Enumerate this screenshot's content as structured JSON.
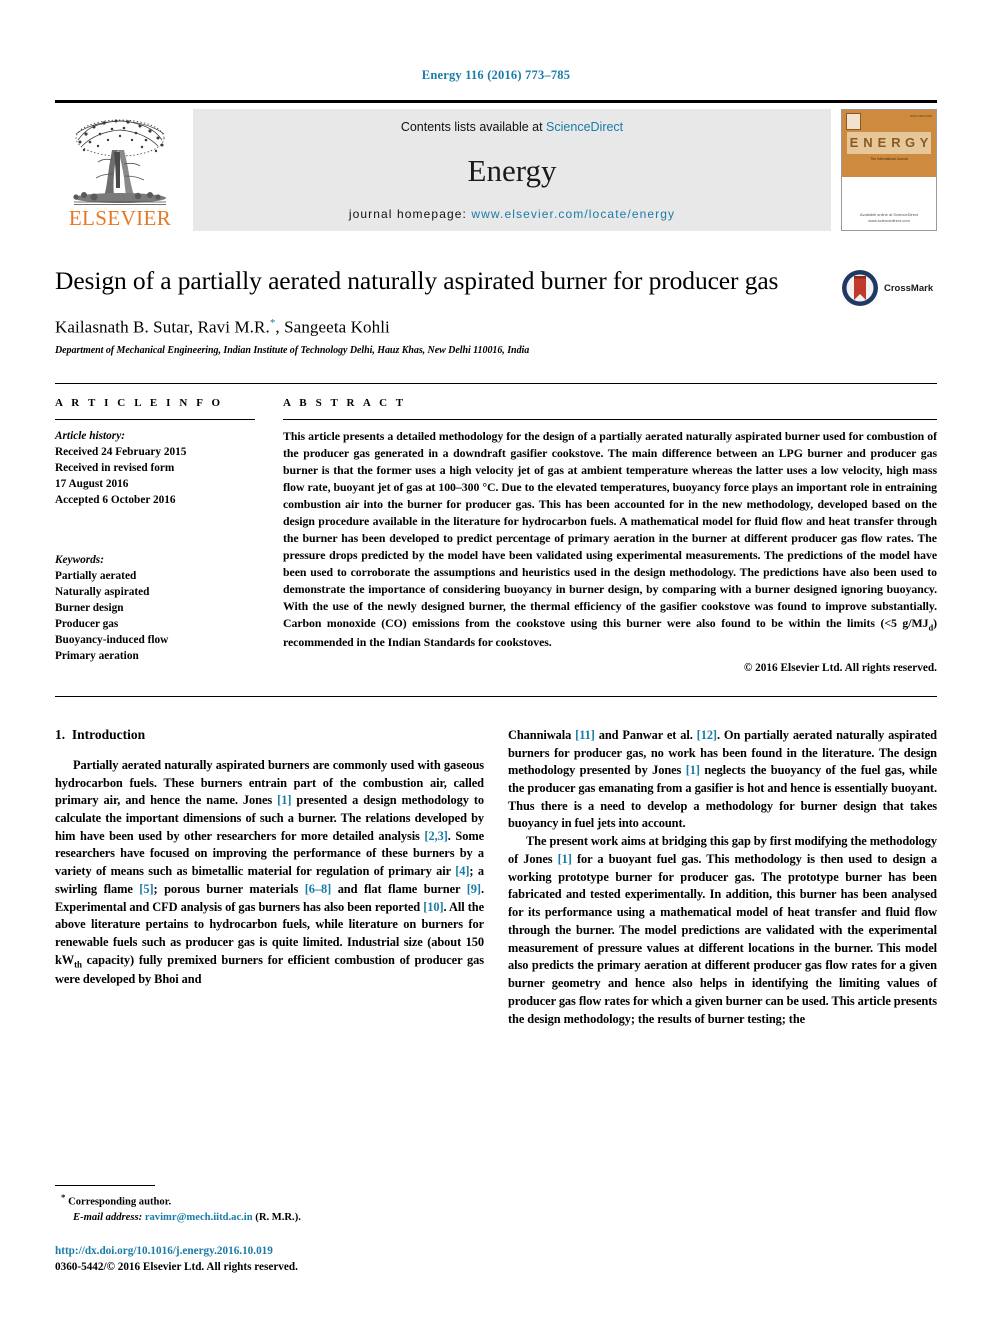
{
  "running_head": "Energy 116 (2016) 773–785",
  "masthead": {
    "publisher": "ELSEVIER",
    "contents_prefix": "Contents lists available at ",
    "contents_link": "ScienceDirect",
    "journal_name": "Energy",
    "homepage_prefix": "journal homepage: ",
    "homepage_url": "www.elsevier.com/locate/energy",
    "cover": {
      "title": "ENERGY",
      "subtitle": "The International Journal",
      "corner_note": "ISSN 0360-5442",
      "publisher_note": "Available online at\nScienceDirect\nwww.sciencedirect.com"
    }
  },
  "article": {
    "title": "Design of a partially aerated naturally aspirated burner for producer gas",
    "authors": "Kailasnath B. Sutar, Ravi M.R.",
    "author_marker": "*",
    "authors_tail": ", Sangeeta Kohli",
    "affiliation": "Department of Mechanical Engineering, Indian Institute of Technology Delhi, Hauz Khas, New Delhi 110016, India",
    "crossmark_label": "CrossMark"
  },
  "article_info": {
    "heading": "A R T I C L E   I N F O",
    "history_label": "Article history:",
    "history": [
      "Received 24 February 2015",
      "Received in revised form",
      "17 August 2016",
      "Accepted 6 October 2016"
    ],
    "keywords_label": "Keywords:",
    "keywords": [
      "Partially aerated",
      "Naturally aspirated",
      "Burner design",
      "Producer gas",
      "Buoyancy-induced flow",
      "Primary aeration"
    ]
  },
  "abstract": {
    "heading": "A B S T R A C T",
    "text": "This article presents a detailed methodology for the design of a partially aerated naturally aspirated burner used for combustion of the producer gas generated in a downdraft gasifier cookstove. The main difference between an LPG burner and producer gas burner is that the former uses a high velocity jet of gas at ambient temperature whereas the latter uses a low velocity, high mass flow rate, buoyant jet of gas at 100–300 °C. Due to the elevated temperatures, buoyancy force plays an important role in entraining combustion air into the burner for producer gas. This has been accounted for in the new methodology, developed based on the design procedure available in the literature for hydrocarbon fuels. A mathematical model for fluid flow and heat transfer through the burner has been developed to predict percentage of primary aeration in the burner at different producer gas flow rates. The pressure drops predicted by the model have been validated using experimental measurements. The predictions of the model have been used to corroborate the assumptions and heuristics used in the design methodology. The predictions have also been used to demonstrate the importance of considering buoyancy in burner design, by comparing with a burner designed ignoring buoyancy. With the use of the newly designed burner, the thermal efficiency of the gasifier cookstove was found to improve substantially. Carbon monoxide (CO) emissions from the cookstove using this burner were also found to be within the limits (<5 g/MJ",
    "text_sub": "d",
    "text_tail": ") recommended in the Indian Standards for cookstoves.",
    "copyright": "© 2016 Elsevier Ltd. All rights reserved."
  },
  "body": {
    "section_number": "1.",
    "section_title": "Introduction",
    "left_p1_a": "Partially aerated naturally aspirated burners are commonly used with gaseous hydrocarbon fuels. These burners entrain part of the combustion air, called primary air, and hence the name. Jones ",
    "left_cite_1": "[1]",
    "left_p1_b": " presented a design methodology to calculate the important dimensions of such a burner. The relations developed by him have been used by other researchers for more detailed analysis ",
    "left_cite_23": "[2,3]",
    "left_p1_c": ". Some researchers have focused on improving the performance of these burners by a variety of means such as bimetallic material for regulation of primary air ",
    "left_cite_4": "[4]",
    "left_p1_d": "; a swirling flame ",
    "left_cite_5": "[5]",
    "left_p1_e": "; porous burner materials ",
    "left_cite_68": "[6–8]",
    "left_p1_f": " and flat flame burner ",
    "left_cite_9": "[9]",
    "left_p1_g": ". Experimental and CFD analysis of gas burners has also been reported ",
    "left_cite_10": "[10]",
    "left_p1_h": ". All the above literature pertains to hydrocarbon fuels, while literature on burners for renewable fuels such as producer gas is quite limited. Industrial size (about 150 kW",
    "left_sub_th": "th",
    "left_p1_i": " capacity) fully premixed burners for efficient combustion of producer gas were developed by Bhoi and",
    "right_p1_a": "Channiwala ",
    "right_cite_11": "[11]",
    "right_p1_b": " and Panwar et al. ",
    "right_cite_12": "[12]",
    "right_p1_c": ". On partially aerated naturally aspirated burners for producer gas, no work has been found in the literature. The design methodology presented by Jones ",
    "right_cite_1": "[1]",
    "right_p1_d": " neglects the buoyancy of the fuel gas, while the producer gas emanating from a gasifier is hot and hence is essentially buoyant. Thus there is a need to develop a methodology for burner design that takes buoyancy in fuel jets into account.",
    "right_p2_a": "The present work aims at bridging this gap by first modifying the methodology of Jones ",
    "right_cite_1b": "[1]",
    "right_p2_b": " for a buoyant fuel gas. This methodology is then used to design a working prototype burner for producer gas. The prototype burner has been fabricated and tested experimentally. In addition, this burner has been analysed for its performance using a mathematical model of heat transfer and fluid flow through the burner. The model predictions are validated with the experimental measurement of pressure values at different locations in the burner. This model also predicts the primary aeration at different producer gas flow rates for a given burner geometry and hence also helps in identifying the limiting values of producer gas flow rates for which a given burner can be used. This article presents the design methodology; the results of burner testing; the"
  },
  "footer": {
    "corr_marker": "*",
    "corr_author": " Corresponding author.",
    "email_label": "E-mail address:",
    "email": "ravimr@mech.iitd.ac.in",
    "email_suffix": " (R. M.R.).",
    "doi": "http://dx.doi.org/10.1016/j.energy.2016.10.019",
    "issn": "0360-5442/© 2016 Elsevier Ltd. All rights reserved."
  },
  "colors": {
    "link": "#1a7ba8",
    "elsevier_orange": "#E87722",
    "cover_orange": "#CE8A3F",
    "band_gray": "#e8e8e8"
  }
}
